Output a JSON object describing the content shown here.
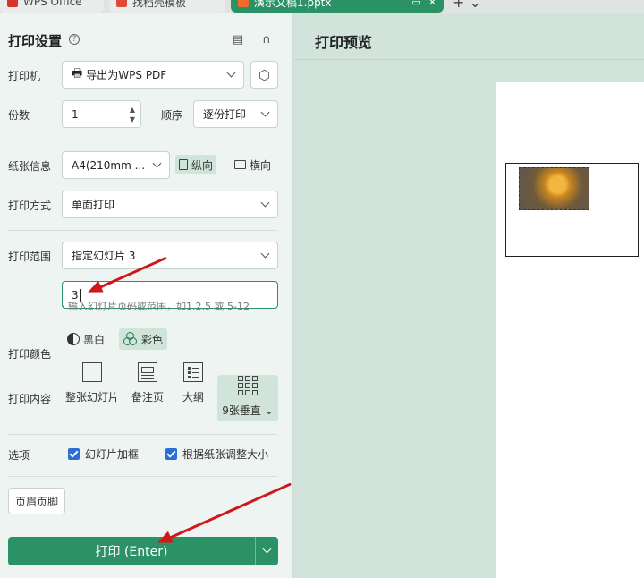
{
  "tabs": [
    {
      "label": "WPS Office"
    },
    {
      "label": "找稻壳模板"
    },
    {
      "label": "演示文稿1.pptx"
    }
  ],
  "panel": {
    "title": "打印设置",
    "printer": {
      "label": "打印机",
      "value": "导出为WPS PDF"
    },
    "copies": {
      "label": "份数",
      "value": "1"
    },
    "order": {
      "label": "顺序",
      "value": "逐份打印"
    },
    "paper": {
      "label": "纸张信息",
      "value": "A4(210mm ...",
      "portrait": "纵向",
      "landscape": "横向"
    },
    "mode": {
      "label": "打印方式",
      "value": "单面打印"
    },
    "range": {
      "label": "打印范围",
      "value": "指定幻灯片 3",
      "input": "3",
      "hint": "· 输入幻灯片页码或范围，如1,2,5 或 5-12"
    },
    "color": {
      "label": "打印颜色",
      "bw": "黑白",
      "color": "彩色"
    },
    "content": {
      "label": "打印内容",
      "full": "整张幻灯片",
      "notes": "备注页",
      "outline": "大纲",
      "handout": "9张垂直"
    },
    "options": {
      "label": "选项",
      "frame": "幻灯片加框",
      "fit": "根据纸张调整大小"
    },
    "header_footer": "页眉页脚",
    "print_button": "打印 (Enter)"
  },
  "preview": {
    "title": "打印预览"
  },
  "colors": {
    "accent": "#2a9264",
    "selected_bg": "#d0e4da",
    "checkbox": "#2b6fd6",
    "arrow": "#d01818"
  }
}
